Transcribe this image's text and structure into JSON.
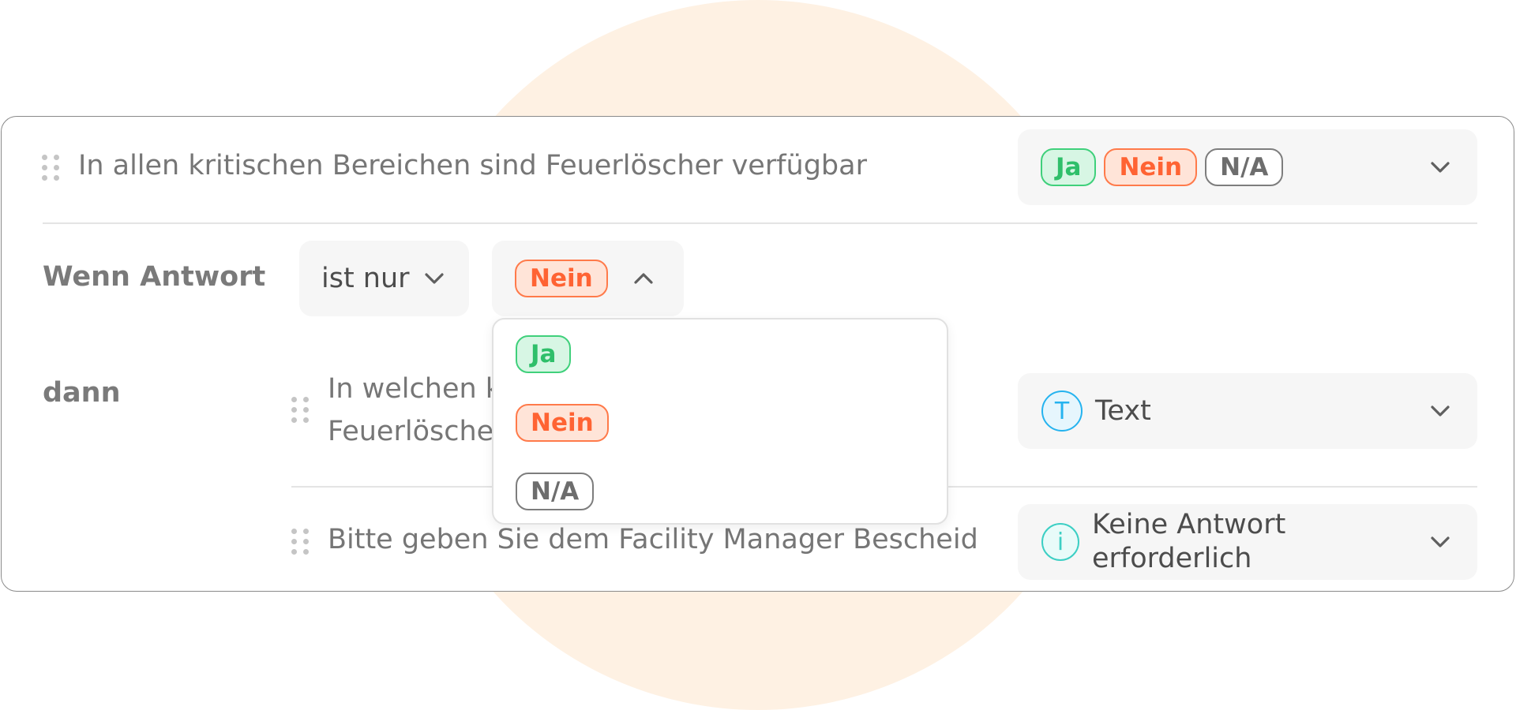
{
  "question": {
    "text": "In allen kritischen Bereichen sind Feuerlöscher verfügbar",
    "answers": {
      "ja": "Ja",
      "nein": "Nein",
      "na": "N/A"
    }
  },
  "logic": {
    "if_label": "Wenn Antwort",
    "operator": "ist nur",
    "selected_value": "Nein",
    "then_label": "dann",
    "dropdown_options": [
      "Ja",
      "Nein",
      "N/A"
    ]
  },
  "followups": [
    {
      "text_line1": "In welchen k",
      "text_line2": "Feuerlösche",
      "type_icon": "T",
      "type_label": "Text"
    },
    {
      "text": "Bitte geben Sie dem Facility Manager Bescheid",
      "type_icon": "i",
      "type_label_line1": "Keine Antwort",
      "type_label_line2": "erforderlich"
    }
  ],
  "colors": {
    "ja": "#2fbf6a",
    "nein": "#ff6333",
    "na": "#6d6d6d",
    "text_icon": "#25b3ef",
    "info_icon": "#3ccfc4",
    "background_circle": "#fef1e3"
  }
}
